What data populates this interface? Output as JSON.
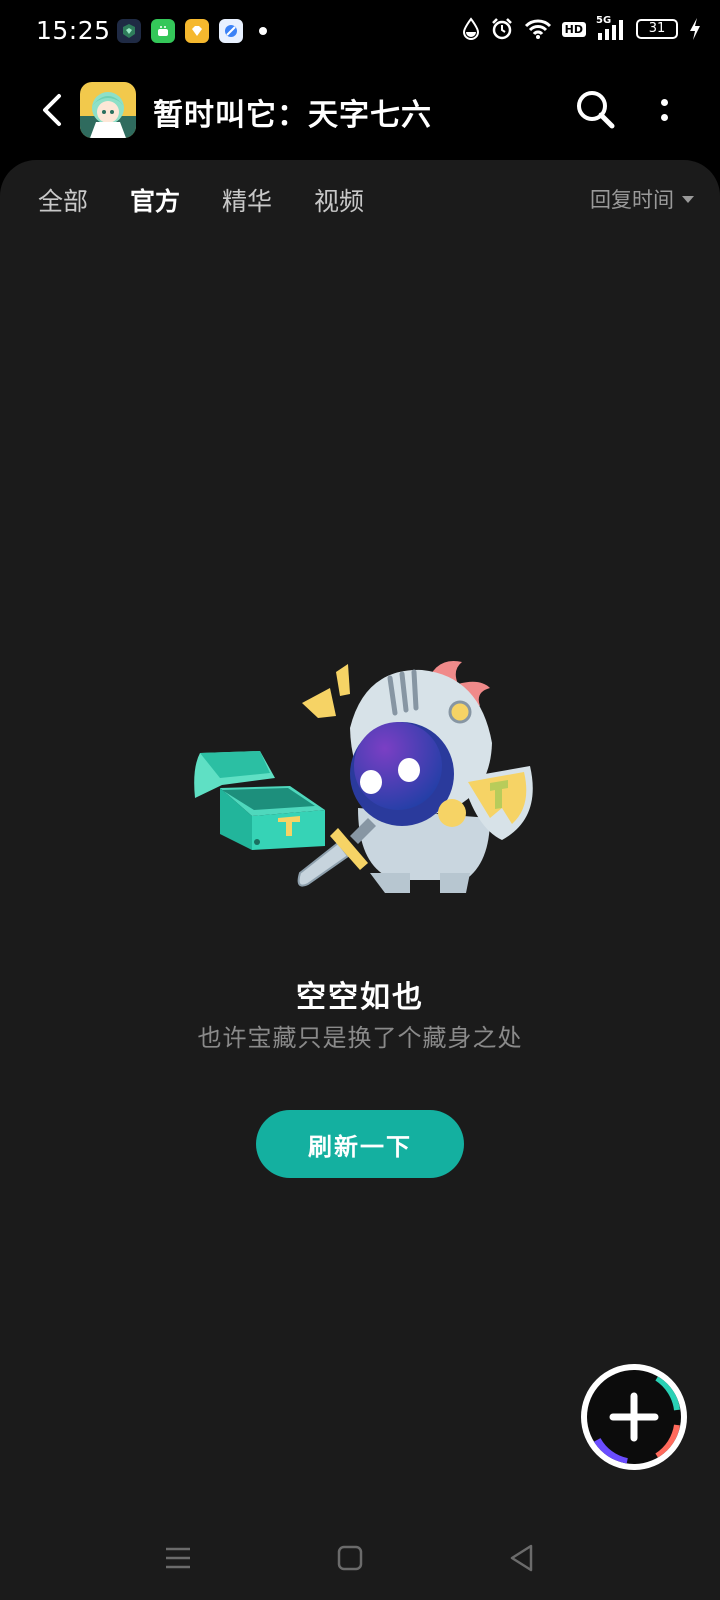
{
  "status_bar": {
    "time": "15:25",
    "notification_icons": [
      "vpn-app-icon",
      "android-store-icon",
      "diamond-app-icon",
      "browser-app-icon"
    ],
    "system_icons": [
      "water-drop-icon",
      "alarm-icon",
      "wifi-icon",
      "hd-icon",
      "signal-5g-icon",
      "battery-icon",
      "charging-icon"
    ],
    "hd_label": "HD",
    "network_label": "5G",
    "battery_level": "31"
  },
  "header": {
    "title": "暂时叫它：天字七六",
    "avatar": "game-avatar-icon"
  },
  "tabs": [
    {
      "label": "全部",
      "active": false
    },
    {
      "label": "官方",
      "active": true
    },
    {
      "label": "精华",
      "active": false
    },
    {
      "label": "视频",
      "active": false
    }
  ],
  "sort": {
    "label": "回复时间"
  },
  "empty_state": {
    "illustration": "knight-with-treasure-chest",
    "title": "空空如也",
    "subtitle": "也许宝藏只是换了个藏身之处",
    "button_label": "刷新一下"
  },
  "colors": {
    "accent": "#14b0a0",
    "panel_bg": "#1b1b1b",
    "background": "#000000"
  }
}
